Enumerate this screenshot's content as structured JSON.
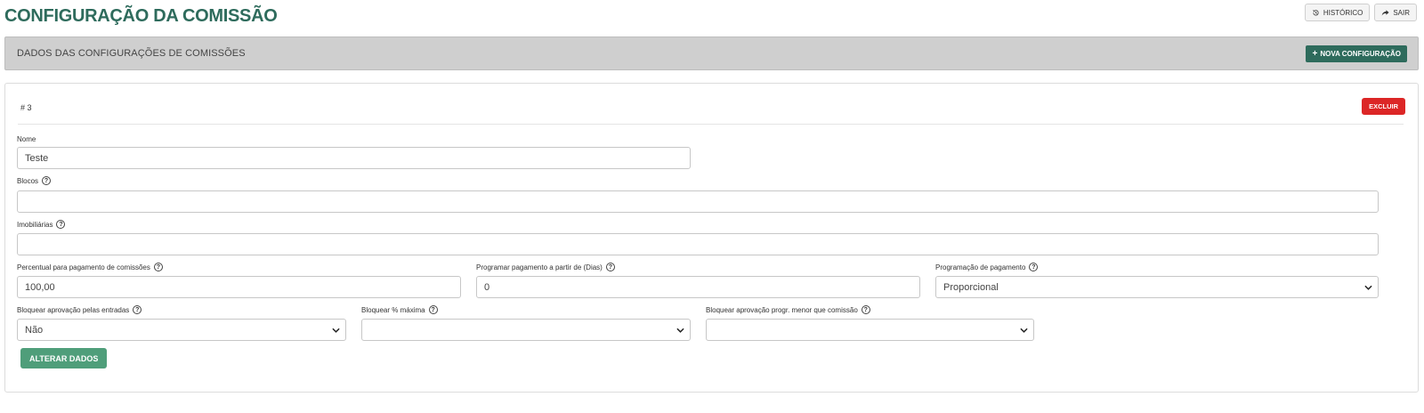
{
  "page": {
    "title": "CONFIGURAÇÃO DA COMISSÃO",
    "actions": {
      "history_label": "HISTÓRICO",
      "exit_label": "SAIR"
    }
  },
  "section": {
    "title": "DADOS DAS CONFIGURAÇÕES DE COMISSÕES",
    "new_config_label": "NOVA CONFIGURAÇÃO"
  },
  "record": {
    "id_label": "# 3",
    "delete_label": "EXCLUIR",
    "fields": {
      "nome": {
        "label": "Nome",
        "value": "Teste"
      },
      "blocos": {
        "label": "Blocos",
        "value": ""
      },
      "imobiliarias": {
        "label": "Imobiliárias",
        "value": ""
      },
      "percentual": {
        "label": "Percentual para pagamento de comissões",
        "value": "100,00"
      },
      "programar_dias": {
        "label": "Programar pagamento a partir de (Dias)",
        "value": "0"
      },
      "programacao": {
        "label": "Programação de pagamento",
        "value": "Proporcional"
      },
      "bloquear_entradas": {
        "label": "Bloquear aprovação pelas entradas",
        "value": "Não"
      },
      "bloquear_maxima": {
        "label": "Bloquear % máxima",
        "value": ""
      },
      "bloquear_progr": {
        "label": "Bloquear aprovação progr. menor que comissão",
        "value": ""
      }
    },
    "submit_label": "ALTERAR DADOS"
  },
  "colors": {
    "brand_green": "#2e6b5c",
    "submit_green": "#4f9e7a",
    "danger_red": "#dc2626",
    "section_gray": "#cfcfcf"
  },
  "icons": {
    "history": "history-icon",
    "exit": "share-arrow-icon",
    "add": "plus-icon",
    "help": "question-circle-icon",
    "chevron": "chevron-down-icon"
  }
}
